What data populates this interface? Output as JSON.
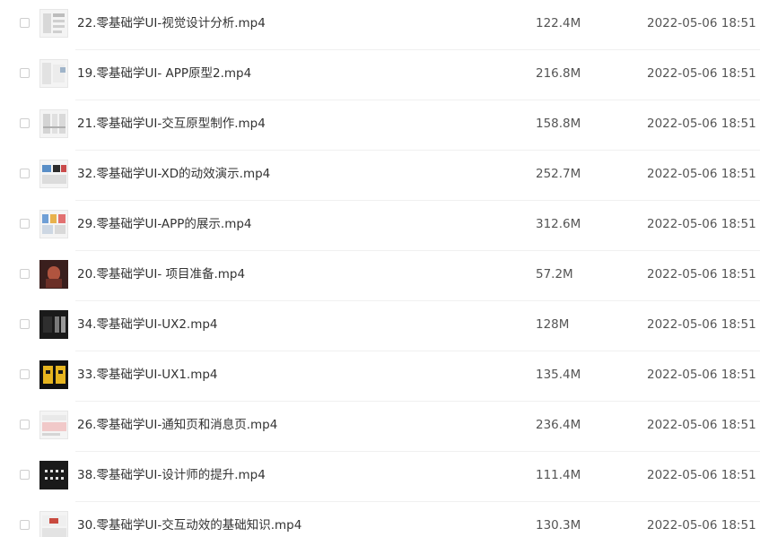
{
  "files": [
    {
      "name": "22.零基础学UI-视觉设计分析.mp4",
      "size": "122.4M",
      "date": "2022-05-06 18:51",
      "thumb": "light"
    },
    {
      "name": "19.零基础学UI- APP原型2.mp4",
      "size": "216.8M",
      "date": "2022-05-06 18:51",
      "thumb": "light"
    },
    {
      "name": "21.零基础学UI-交互原型制作.mp4",
      "size": "158.8M",
      "date": "2022-05-06 18:51",
      "thumb": "light"
    },
    {
      "name": "32.零基础学UI-XD的动效演示.mp4",
      "size": "252.7M",
      "date": "2022-05-06 18:51",
      "thumb": "light-colored"
    },
    {
      "name": "29.零基础学UI-APP的展示.mp4",
      "size": "312.6M",
      "date": "2022-05-06 18:51",
      "thumb": "light-colored"
    },
    {
      "name": "20.零基础学UI- 项目准备.mp4",
      "size": "57.2M",
      "date": "2022-05-06 18:51",
      "thumb": "red"
    },
    {
      "name": "34.零基础学UI-UX2.mp4",
      "size": "128M",
      "date": "2022-05-06 18:51",
      "thumb": "dark"
    },
    {
      "name": "33.零基础学UI-UX1.mp4",
      "size": "135.4M",
      "date": "2022-05-06 18:51",
      "thumb": "yellow"
    },
    {
      "name": "26.零基础学UI-通知页和消息页.mp4",
      "size": "236.4M",
      "date": "2022-05-06 18:51",
      "thumb": "light-pink"
    },
    {
      "name": "38.零基础学UI-设计师的提升.mp4",
      "size": "111.4M",
      "date": "2022-05-06 18:51",
      "thumb": "dark-grid"
    },
    {
      "name": "30.零基础学UI-交互动效的基础知识.mp4",
      "size": "130.3M",
      "date": "2022-05-06 18:51",
      "thumb": "light-red"
    }
  ]
}
